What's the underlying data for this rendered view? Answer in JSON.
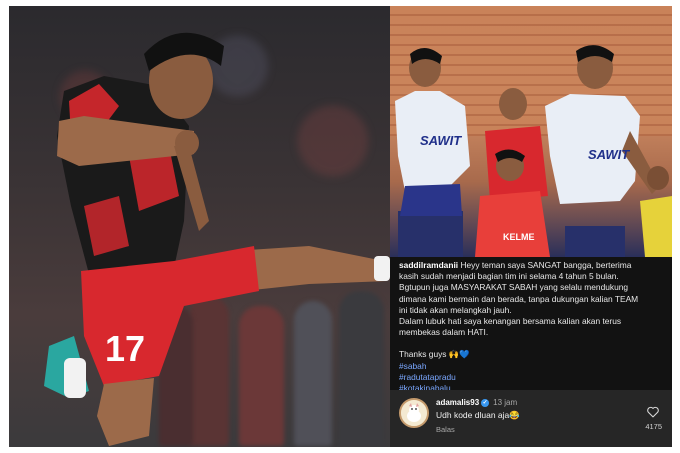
{
  "left_photo": {
    "jersey_number": "17"
  },
  "right_photo": {
    "sponsor_left": "SAWIT",
    "sponsor_right": "SAWIT",
    "kit_text": "KELME"
  },
  "post": {
    "username": "saddilramdanii",
    "lines": [
      "Heyy teman saya SANGAT bangga, berterima",
      "kasih sudah menjadi bagian tim ini selama 4 tahun 5 bulan.",
      "Bgtupun juga MASYARAKAT SABAH yang selalu mendukung",
      "dimana kami bermain dan berada, tanpa dukungan kalian TEAM",
      "ini tidak akan melangkah jauh.",
      "Dalam lubuk hati saya kenangan bersama kalian akan terus",
      "membekas dalam HATI."
    ],
    "thanks": "Thanks guys 🙌💙",
    "hashtags": [
      "#sabah",
      "#radutatapradu",
      "#kotakinabalu"
    ]
  },
  "comment": {
    "username": "adamalis93",
    "time": "13 jam",
    "text": "Udh kode dluan aja😂",
    "reply_label": "Balas",
    "like_count": "4175",
    "verified_mark": "✓"
  },
  "colors": {
    "hashtag": "#7aa7ff",
    "panel_bg": "#121212",
    "comment_bg": "#262626",
    "jersey_red": "#d8282e"
  },
  "icons": {
    "like": "heart-icon",
    "verified": "verified-badge-icon"
  }
}
